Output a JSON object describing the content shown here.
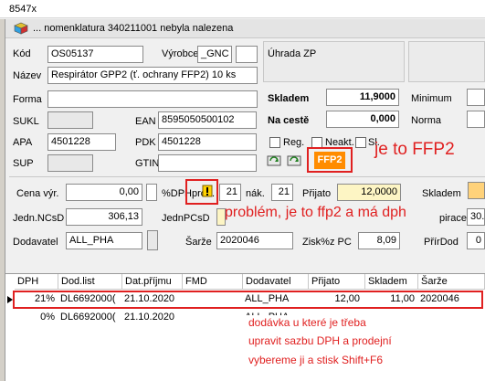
{
  "window": {
    "title": "8547x"
  },
  "message": {
    "text": "... nomenklatura 340211001 nebyla nalezena"
  },
  "form": {
    "kod": {
      "label": "Kód",
      "value": "OS05137"
    },
    "vyrobce": {
      "label": "Výrobce",
      "value": "_GNC"
    },
    "uhrada": {
      "label": "Úhrada ZP"
    },
    "nazev": {
      "label": "Název",
      "value": "Respirátor GPP2 (ť. ochrany FFP2) 10 ks"
    },
    "forma": {
      "label": "Forma"
    },
    "skladem": {
      "label": "Skladem",
      "value": "11,9000"
    },
    "minimum": {
      "label": "Minimum"
    },
    "sukl": {
      "label": "SUKL"
    },
    "ean": {
      "label": "EAN",
      "value": "8595050500102"
    },
    "na_ceste": {
      "label": "Na cestě",
      "value": "0,000"
    },
    "norma": {
      "label": "Norma"
    },
    "apa": {
      "label": "APA",
      "value": "4501228"
    },
    "pdk": {
      "label": "PDK",
      "value": "4501228"
    },
    "reg": {
      "label": "Reg."
    },
    "neakt": {
      "label": "Neakt."
    },
    "sl": {
      "label": "Sl."
    },
    "sup": {
      "label": "SUP"
    },
    "gtin": {
      "label": "GTIN"
    },
    "badge": {
      "text": "FFP2",
      "color": "#ff8c00"
    },
    "cena_vyr": {
      "label": "Cena výr.",
      "value": "0,00"
    },
    "dph_pct": {
      "label": "%DPH"
    },
    "prod": {
      "label": "prod.",
      "value": "21"
    },
    "nak_label": "nák.",
    "nak": {
      "value": "21"
    },
    "prijato": {
      "label": "Přijato",
      "value": "12,0000"
    },
    "skladem2": {
      "label": "Skladem"
    },
    "jedn_ncsd": {
      "label": "Jedn.NCsD",
      "value": "306,13"
    },
    "jedn_pcsd": {
      "label": "JednPCsD"
    },
    "pirace": {
      "label": "pirace",
      "value": "30."
    },
    "dodavatel": {
      "label": "Dodavatel",
      "value": "ALL_PHA"
    },
    "sarze": {
      "label": "Šarže",
      "value": "2020046"
    },
    "zisk": {
      "label": "Zisk%z PC",
      "value": "8,09"
    },
    "prirdod": {
      "label": "PřírDod",
      "value": "0"
    }
  },
  "annotations": {
    "a1": "je to FFP2",
    "a2": "problém, je to ffp2 a má dph",
    "a3_line1": "dodávka u které je třeba",
    "a3_line2": "upravit sazbu DPH a prodejní",
    "a3_line3": "vybereme ji a stisk Shift+F6",
    "color": "#e02020"
  },
  "table": {
    "columns": [
      "DPH",
      "Dod.list",
      "Dat.příjmu",
      "FMD",
      "Dodavatel",
      "Přijato",
      "Skladem",
      "Šarže"
    ],
    "rows": [
      {
        "dph": "21%",
        "dodlist": "DL6692000(",
        "datum": "21.10.2020",
        "fmd": "",
        "dodavatel": "ALL_PHA",
        "prijato": "12,00",
        "skladem": "11,00",
        "sarze": "2020046",
        "selected": true
      },
      {
        "dph": "0%",
        "dodlist": "DL6692000(",
        "datum": "21.10.2020",
        "fmd": "",
        "dodavatel": "ALL_PHA",
        "prijato": "",
        "skladem": "",
        "sarze": "",
        "selected": false
      }
    ]
  }
}
